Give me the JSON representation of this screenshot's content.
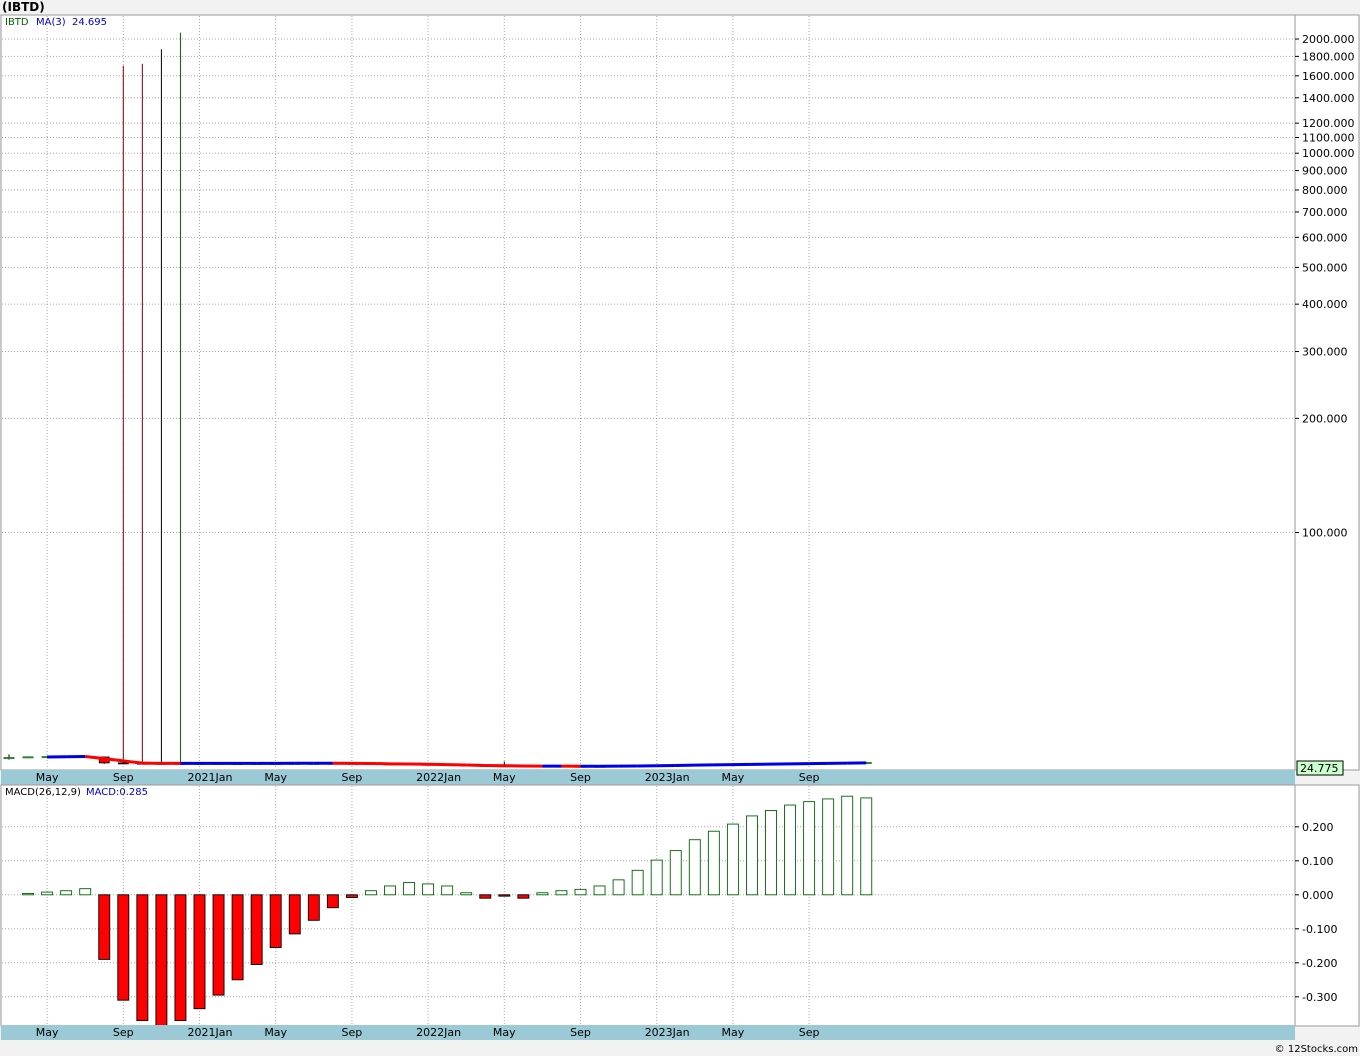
{
  "title": "(IBTD)",
  "credit": "© 12Stocks.com",
  "colors": {
    "up": "#006400",
    "down": "#ff0000",
    "ma_up": "#0000e6",
    "ma_down": "#ff0000",
    "axis_band": "#9bc9d6",
    "grid": "#a6a6a6",
    "last_box": "#ccffcc"
  },
  "month_labels": [
    "May",
    "Sep",
    "2021Jan",
    "May",
    "Sep",
    "2022Jan",
    "May",
    "Sep",
    "2023Jan",
    "May",
    "Sep"
  ],
  "chart_data": [
    {
      "type": "candlestick",
      "panel": "price",
      "legend": {
        "symbol": "IBTD",
        "ma_label": "MA(3)",
        "ma_value": "24.695"
      },
      "y_scale": "log",
      "ylim": [
        23.8,
        2300
      ],
      "y_ticks": [
        100,
        200,
        300,
        400,
        500,
        600,
        700,
        800,
        900,
        1000,
        1100,
        1200,
        1400,
        1600,
        1800,
        2000
      ],
      "y_tick_labels": [
        "100.000",
        "200.000",
        "300.000",
        "400.000",
        "500.000",
        "600.000",
        "700.000",
        "800.000",
        "900.000",
        "1000.000",
        "1100.000",
        "1200.000",
        "1400.000",
        "1600.000",
        "1800.000",
        "2000.000"
      ],
      "last_price": "24.775",
      "candles": [
        {
          "month": "2020-03",
          "open": 25.45,
          "high": 26.0,
          "low": 25.2,
          "close": 25.5
        },
        {
          "month": "2020-04",
          "open": 25.6,
          "high": 25.7,
          "low": 25.55,
          "close": 25.62
        },
        {
          "month": "2020-05",
          "open": 25.62,
          "high": 25.68,
          "low": 25.58,
          "close": 25.65
        },
        {
          "month": "2020-06",
          "open": 25.65,
          "high": 25.7,
          "low": 25.6,
          "close": 25.66
        },
        {
          "month": "2020-07",
          "open": 25.66,
          "high": 25.72,
          "low": 25.62,
          "close": 25.7
        },
        {
          "month": "2020-08",
          "open": 25.6,
          "high": 25.65,
          "low": 24.55,
          "close": 24.7
        },
        {
          "month": "2020-09",
          "open": 24.7,
          "high": 1700,
          "low": 24.6,
          "close": 24.65
        },
        {
          "month": "2020-10",
          "open": 24.65,
          "high": 1720,
          "low": 24.6,
          "close": 24.62
        },
        {
          "month": "2020-11",
          "open": 24.62,
          "high": 1880,
          "low": 24.58,
          "close": 24.62
        },
        {
          "month": "2020-12",
          "open": 24.6,
          "high": 2080,
          "low": 24.58,
          "close": 24.63
        },
        {
          "month": "2021-01",
          "open": 24.63,
          "high": 24.66,
          "low": 24.6,
          "close": 24.64
        },
        {
          "month": "2021-02",
          "open": 24.64,
          "high": 24.66,
          "low": 24.61,
          "close": 24.63
        },
        {
          "month": "2021-03",
          "open": 24.63,
          "high": 24.65,
          "low": 24.6,
          "close": 24.62
        },
        {
          "month": "2021-04",
          "open": 24.62,
          "high": 24.66,
          "low": 24.6,
          "close": 24.64
        },
        {
          "month": "2021-05",
          "open": 24.64,
          "high": 24.66,
          "low": 24.6,
          "close": 24.63
        },
        {
          "month": "2021-06",
          "open": 24.63,
          "high": 24.66,
          "low": 24.61,
          "close": 24.64
        },
        {
          "month": "2021-07",
          "open": 24.64,
          "high": 24.66,
          "low": 24.61,
          "close": 24.64
        },
        {
          "month": "2021-08",
          "open": 24.64,
          "high": 24.66,
          "low": 24.61,
          "close": 24.65
        },
        {
          "month": "2021-09",
          "open": 24.65,
          "high": 24.66,
          "low": 24.58,
          "close": 24.6
        },
        {
          "month": "2021-10",
          "open": 24.6,
          "high": 24.62,
          "low": 24.55,
          "close": 24.57
        },
        {
          "month": "2021-11",
          "open": 24.57,
          "high": 24.59,
          "low": 24.5,
          "close": 24.52
        },
        {
          "month": "2021-12",
          "open": 24.52,
          "high": 24.55,
          "low": 24.48,
          "close": 24.5
        },
        {
          "month": "2022-01",
          "open": 24.5,
          "high": 24.52,
          "low": 24.42,
          "close": 24.44
        },
        {
          "month": "2022-02",
          "open": 24.44,
          "high": 24.46,
          "low": 24.36,
          "close": 24.38
        },
        {
          "month": "2022-03",
          "open": 24.38,
          "high": 24.4,
          "low": 24.3,
          "close": 24.32
        },
        {
          "month": "2022-04",
          "open": 24.32,
          "high": 24.34,
          "low": 24.25,
          "close": 24.27
        },
        {
          "month": "2022-05",
          "open": 24.27,
          "high": 24.9,
          "low": 24.22,
          "close": 24.24
        },
        {
          "month": "2022-06",
          "open": 24.24,
          "high": 24.27,
          "low": 24.18,
          "close": 24.21
        },
        {
          "month": "2022-07",
          "open": 24.21,
          "high": 24.25,
          "low": 24.17,
          "close": 24.22
        },
        {
          "month": "2022-08",
          "open": 24.22,
          "high": 24.25,
          "low": 24.18,
          "close": 24.21
        },
        {
          "month": "2022-09",
          "open": 24.21,
          "high": 24.23,
          "low": 24.16,
          "close": 24.18
        },
        {
          "month": "2022-10",
          "open": 24.18,
          "high": 24.22,
          "low": 24.16,
          "close": 24.2
        },
        {
          "month": "2022-11",
          "open": 24.2,
          "high": 24.26,
          "low": 24.18,
          "close": 24.24
        },
        {
          "month": "2022-12",
          "open": 24.24,
          "high": 24.3,
          "low": 24.22,
          "close": 24.28
        },
        {
          "month": "2023-01",
          "open": 24.28,
          "high": 24.34,
          "low": 24.26,
          "close": 24.32
        },
        {
          "month": "2023-02",
          "open": 24.32,
          "high": 24.38,
          "low": 24.3,
          "close": 24.36
        },
        {
          "month": "2023-03",
          "open": 24.36,
          "high": 24.42,
          "low": 24.34,
          "close": 24.4
        },
        {
          "month": "2023-04",
          "open": 24.4,
          "high": 24.46,
          "low": 24.38,
          "close": 24.44
        },
        {
          "month": "2023-05",
          "open": 24.44,
          "high": 24.5,
          "low": 24.42,
          "close": 24.48
        },
        {
          "month": "2023-06",
          "open": 24.48,
          "high": 24.54,
          "low": 24.46,
          "close": 24.52
        },
        {
          "month": "2023-07",
          "open": 24.52,
          "high": 24.57,
          "low": 24.5,
          "close": 24.55
        },
        {
          "month": "2023-08",
          "open": 24.55,
          "high": 24.61,
          "low": 24.53,
          "close": 24.59
        },
        {
          "month": "2023-09",
          "open": 24.59,
          "high": 24.64,
          "low": 24.57,
          "close": 24.62
        },
        {
          "month": "2023-10",
          "open": 24.62,
          "high": 24.68,
          "low": 24.6,
          "close": 24.66
        },
        {
          "month": "2023-11",
          "open": 24.66,
          "high": 24.72,
          "low": 24.64,
          "close": 24.7
        },
        {
          "month": "2023-12",
          "open": 24.7,
          "high": 24.78,
          "low": 24.68,
          "close": 24.77
        }
      ],
      "ma3": [
        null,
        null,
        25.59,
        25.64,
        25.67,
        25.35,
        25.0,
        24.66,
        24.63,
        24.62,
        24.63,
        24.63,
        24.63,
        24.63,
        24.63,
        24.64,
        24.64,
        24.64,
        24.63,
        24.61,
        24.56,
        24.53,
        24.49,
        24.44,
        24.38,
        24.32,
        24.28,
        24.24,
        24.22,
        24.22,
        24.2,
        24.2,
        24.21,
        24.24,
        24.28,
        24.32,
        24.36,
        24.4,
        24.44,
        24.48,
        24.52,
        24.55,
        24.59,
        24.62,
        24.66,
        24.7
      ]
    },
    {
      "type": "bar",
      "panel": "macd",
      "legend": {
        "label": "MACD(26,12,9)",
        "value_label": "MACD:0.285"
      },
      "ylim": [
        -0.38,
        0.32
      ],
      "y_ticks": [
        0.2,
        0.1,
        0.0,
        -0.1,
        -0.2,
        -0.3
      ],
      "y_tick_labels": [
        "0.200",
        "0.100",
        "0.000",
        "-0.100",
        "-0.200",
        "-0.300"
      ],
      "values": [
        0.004,
        0.008,
        0.012,
        0.018,
        -0.19,
        -0.31,
        -0.37,
        -0.385,
        -0.37,
        -0.335,
        -0.295,
        -0.25,
        -0.205,
        -0.155,
        -0.115,
        -0.075,
        -0.038,
        -0.008,
        0.012,
        0.026,
        0.036,
        0.032,
        0.026,
        0.006,
        -0.01,
        -0.004,
        -0.01,
        0.006,
        0.012,
        0.016,
        0.026,
        0.044,
        0.072,
        0.102,
        0.13,
        0.162,
        0.187,
        0.208,
        0.232,
        0.248,
        0.264,
        0.274,
        0.282,
        0.29,
        0.285
      ]
    }
  ]
}
